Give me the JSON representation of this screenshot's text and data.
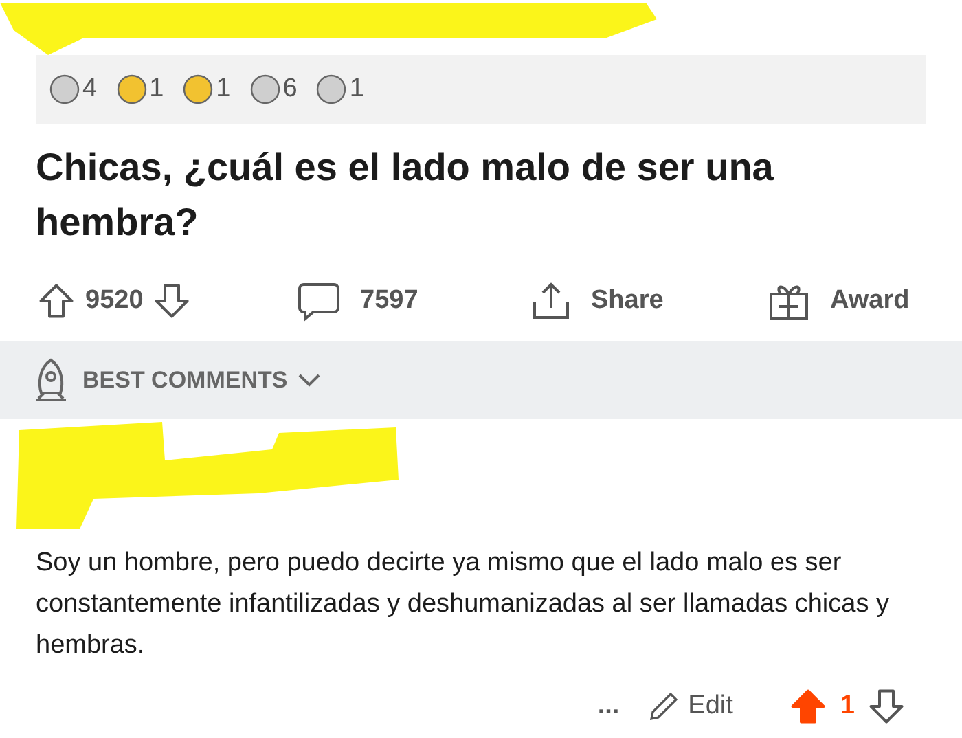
{
  "awards": [
    {
      "kind": "silver",
      "count": "4"
    },
    {
      "kind": "gold",
      "count": "1"
    },
    {
      "kind": "gold",
      "count": "1"
    },
    {
      "kind": "silver",
      "count": "6"
    },
    {
      "kind": "silver",
      "count": "1"
    }
  ],
  "post": {
    "title": "Chicas, ¿cuál es el lado malo de ser una hembra?",
    "votes": "9520",
    "comments": "7597",
    "share": "Share",
    "award": "Award"
  },
  "sort": {
    "label": "BEST COMMENTS"
  },
  "comment": {
    "body": "Soy un hombre, pero puedo decirte ya mismo que el lado malo es ser constantemente infantilizadas y deshumanizadas al ser llamadas chicas y hembras.",
    "more": "...",
    "edit": "Edit",
    "votes": "1",
    "upvoted": true
  }
}
